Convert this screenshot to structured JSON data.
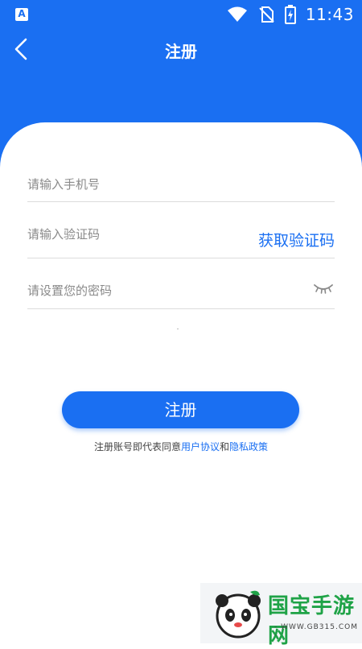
{
  "status_bar": {
    "app_icon_letter": "A",
    "time": "11:43",
    "icons": [
      "wifi-icon",
      "no-sim-icon",
      "battery-charging-icon"
    ]
  },
  "nav": {
    "back_icon": "chevron-left-icon",
    "title": "注册"
  },
  "form": {
    "phone_placeholder": "请输入手机号",
    "code_placeholder": "请输入验证码",
    "get_code_label": "获取验证码",
    "password_placeholder": "请设置您的密码",
    "password_toggle_icon": "eye-closed-icon"
  },
  "register_button_label": "注册",
  "agreement": {
    "prefix": "注册账号即代表同意",
    "user_agreement": "用户协议",
    "and": "和",
    "privacy_policy": "隐私政策"
  },
  "watermark": {
    "brand": "国宝手游网",
    "url": "- WWW.GB315.COM -"
  },
  "colors": {
    "primary": "#1a6ff2",
    "background": "#ffffff",
    "placeholder": "#8a8a8a",
    "divider": "#dcdcdc"
  }
}
